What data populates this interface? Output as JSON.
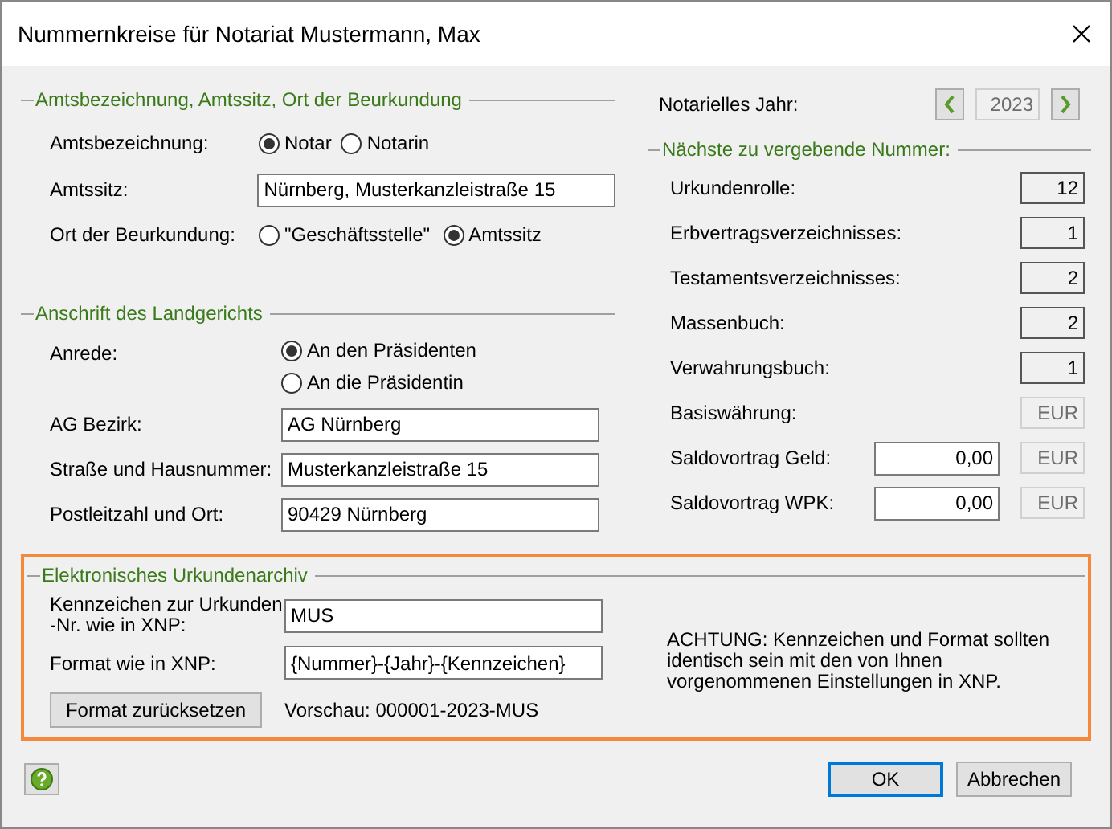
{
  "window": {
    "title": "Nummernkreise für Notariat Mustermann, Max"
  },
  "office_section": {
    "title": "Amtsbezeichnung, Amtssitz, Ort der Beurkundung",
    "designation": {
      "label": "Amtsbezeichnung:",
      "options": [
        {
          "label": "Notar",
          "selected": true
        },
        {
          "label": "Notarin",
          "selected": false
        }
      ]
    },
    "seat": {
      "label": "Amtssitz:",
      "value": "Nürnberg, Musterkanzleistraße 15"
    },
    "place": {
      "label": "Ort der Beurkundung:",
      "options": [
        {
          "label": "\"Geschäftsstelle\"",
          "selected": false
        },
        {
          "label": "Amtssitz",
          "selected": true
        }
      ]
    }
  },
  "court_section": {
    "title": "Anschrift des Landgerichts",
    "salutation": {
      "label": "Anrede:",
      "options": [
        {
          "label": "An den Präsidenten",
          "selected": true
        },
        {
          "label": "An die Präsidentin",
          "selected": false
        }
      ]
    },
    "fields": [
      {
        "label": "AG Bezirk:",
        "value": "AG Nürnberg"
      },
      {
        "label": "Straße und Hausnummer:",
        "value": "Musterkanzleistraße 15"
      },
      {
        "label": "Postleitzahl und Ort:",
        "value": "90429 Nürnberg"
      }
    ]
  },
  "year": {
    "label": "Notarielles Jahr:",
    "value": "2023"
  },
  "numbers_section": {
    "title": "Nächste zu vergebende Nummer:",
    "rows": [
      {
        "kind": "counter",
        "label": "Urkundenrolle:",
        "value": "12"
      },
      {
        "kind": "counter",
        "label": "Erbvertragsverzeichnisses:",
        "value": "1"
      },
      {
        "kind": "counter",
        "label": "Testamentsverzeichnisses:",
        "value": "2"
      },
      {
        "kind": "counter",
        "label": "Massenbuch:",
        "value": "2"
      },
      {
        "kind": "counter",
        "label": "Verwahrungsbuch:",
        "value": "1"
      },
      {
        "kind": "currency",
        "label": "Basiswährung:",
        "currency": "EUR"
      },
      {
        "kind": "amount",
        "label": "Saldovortrag Geld:",
        "value": "0,00",
        "currency": "EUR"
      },
      {
        "kind": "amount",
        "label": "Saldovortrag WPK:",
        "value": "0,00",
        "currency": "EUR"
      }
    ]
  },
  "archive_section": {
    "title": "Elektronisches Urkundenarchiv",
    "highlighted": true,
    "fields": [
      {
        "label": "Kennzeichen zur Urkunden -Nr. wie in XNP:",
        "value": "MUS"
      },
      {
        "label": "Format wie in XNP:",
        "value": "{Nummer}-{Jahr}-{Kennzeichen}"
      }
    ],
    "reset_button": "Format zurücksetzen",
    "preview": "Vorschau: 000001-2023-MUS",
    "notice": "ACHTUNG: Kennzeichen und Format sollten identisch sein mit den von Ihnen vorgenommenen Einstellungen in XNP."
  },
  "buttons": [
    {
      "label": "OK",
      "default": true
    },
    {
      "label": "Abbrechen",
      "default": false
    }
  ]
}
